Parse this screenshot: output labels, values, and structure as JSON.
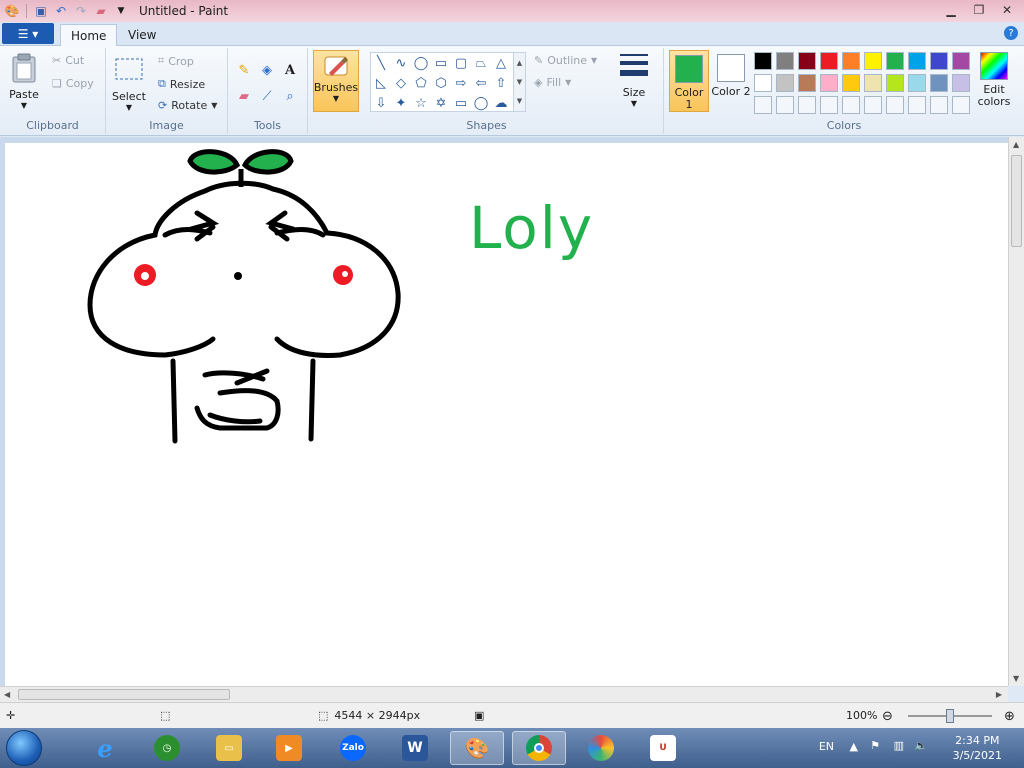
{
  "window": {
    "title": "Untitled - Paint"
  },
  "ribbon": {
    "tabs": [
      {
        "label": "Home"
      },
      {
        "label": "View"
      }
    ],
    "clipboard": {
      "label": "Clipboard",
      "paste": "Paste",
      "cut": "Cut",
      "copy": "Copy"
    },
    "image": {
      "label": "Image",
      "select": "Select",
      "crop": "Crop",
      "resize": "Resize",
      "rotate": "Rotate"
    },
    "tools": {
      "label": "Tools"
    },
    "brushes": {
      "label": "Brushes"
    },
    "shapes": {
      "label": "Shapes",
      "outline": "Outline",
      "fill": "Fill"
    },
    "size": {
      "label": "Size"
    },
    "colors": {
      "label": "Colors",
      "color1_label": "Color 1",
      "color2_label": "Color 2",
      "edit_colors": "Edit colors",
      "color1": "#22b14c",
      "color2": "#ffffff",
      "palette_row1": [
        "#000000",
        "#7f7f7f",
        "#880015",
        "#ed1c24",
        "#ff7f27",
        "#fff200",
        "#22b14c",
        "#00a2e8",
        "#3f48cc",
        "#a349a4"
      ],
      "palette_row2": [
        "#ffffff",
        "#c3c3c3",
        "#b97a57",
        "#ffaec9",
        "#ffc90e",
        "#efe4b0",
        "#b5e61d",
        "#99d9ea",
        "#7092be",
        "#c8bfe7"
      ]
    }
  },
  "canvas": {
    "drawn_text": "Loly"
  },
  "statusbar": {
    "dimensions": "4544 × 2944px",
    "zoom": "100%"
  },
  "taskbar": {
    "apps": [
      {
        "name": "Internet Explorer"
      },
      {
        "name": "Clock"
      },
      {
        "name": "File Explorer"
      },
      {
        "name": "Media"
      },
      {
        "name": "Zalo",
        "text": "Zalo"
      },
      {
        "name": "Word",
        "text": "W"
      },
      {
        "name": "Paint"
      },
      {
        "name": "Chrome"
      },
      {
        "name": "Color app"
      },
      {
        "name": "Unikey"
      }
    ],
    "language": "EN",
    "time": "2:34 PM",
    "date": "3/5/2021"
  }
}
